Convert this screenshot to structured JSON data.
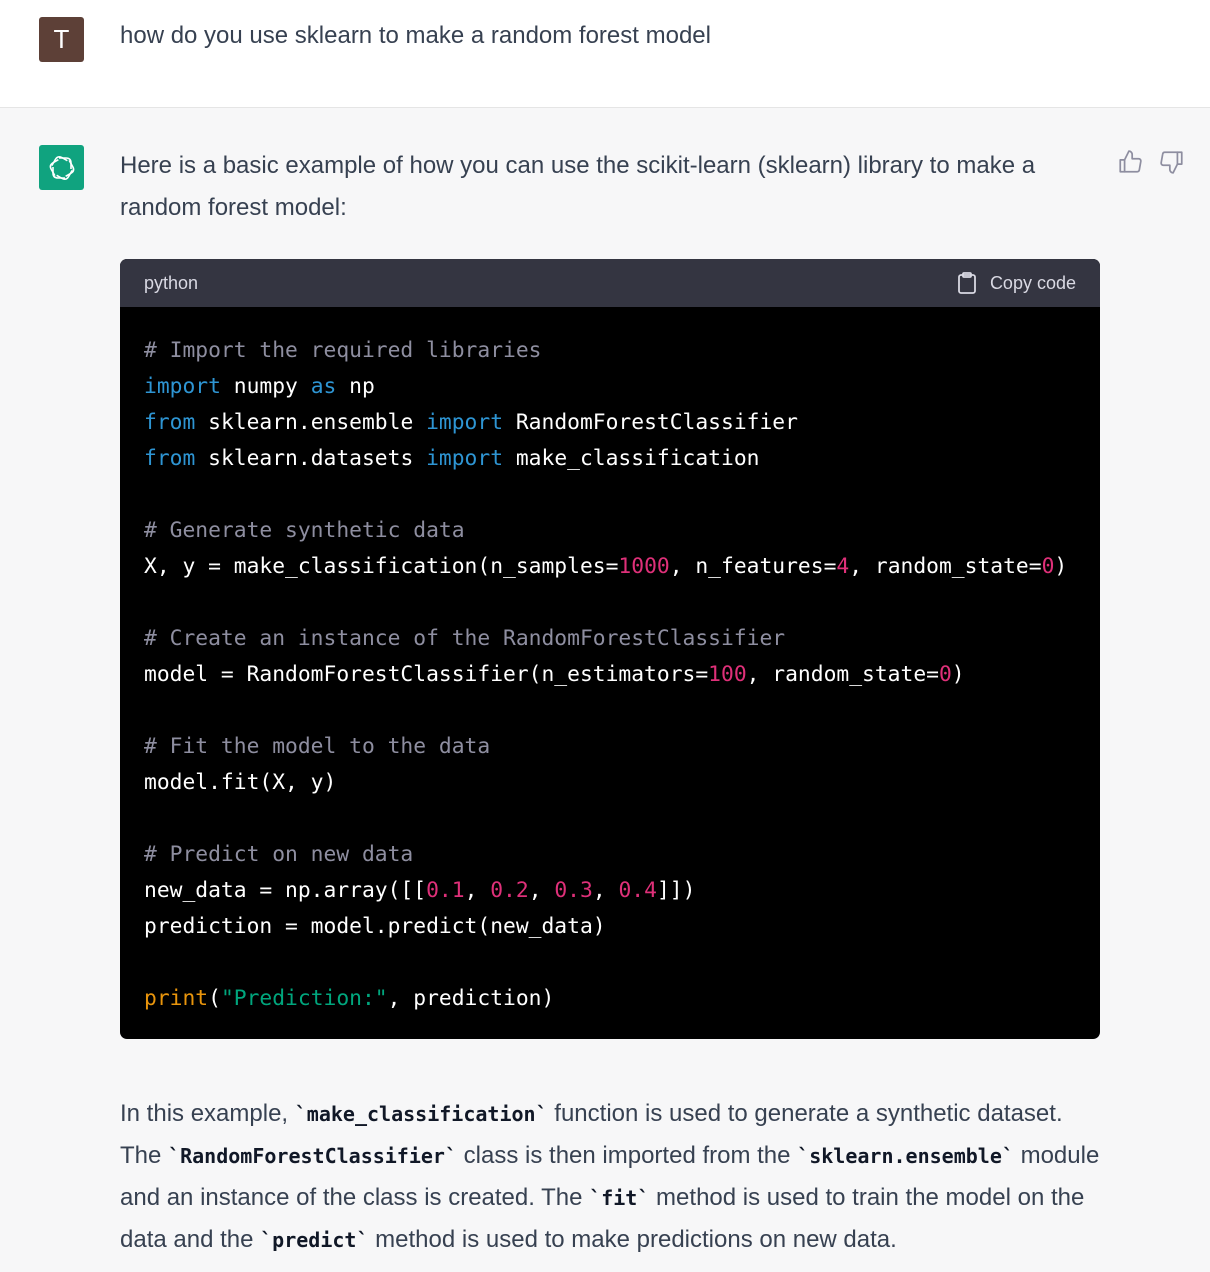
{
  "user_message": {
    "avatar_initial": "T",
    "text": "how do you use sklearn to make a random forest model"
  },
  "assistant_message": {
    "intro": "Here is a basic example of how you can use the scikit-learn (sklearn) library to make a random forest model:",
    "code_block": {
      "language": "python",
      "copy_label": "Copy code",
      "lines": [
        [
          {
            "t": "# Import the required libraries",
            "k": "comment"
          }
        ],
        [
          {
            "t": "import",
            "k": "keyword"
          },
          {
            "t": " numpy ",
            "k": "plain"
          },
          {
            "t": "as",
            "k": "keyword"
          },
          {
            "t": " np",
            "k": "plain"
          }
        ],
        [
          {
            "t": "from",
            "k": "keyword"
          },
          {
            "t": " sklearn.ensemble ",
            "k": "plain"
          },
          {
            "t": "import",
            "k": "keyword"
          },
          {
            "t": " RandomForestClassifier",
            "k": "plain"
          }
        ],
        [
          {
            "t": "from",
            "k": "keyword"
          },
          {
            "t": " sklearn.datasets ",
            "k": "plain"
          },
          {
            "t": "import",
            "k": "keyword"
          },
          {
            "t": " make_classification",
            "k": "plain"
          }
        ],
        [],
        [
          {
            "t": "# Generate synthetic data",
            "k": "comment"
          }
        ],
        [
          {
            "t": "X, y = make_classification(n_samples=",
            "k": "plain"
          },
          {
            "t": "1000",
            "k": "number"
          },
          {
            "t": ", n_features=",
            "k": "plain"
          },
          {
            "t": "4",
            "k": "number"
          },
          {
            "t": ", random_state=",
            "k": "plain"
          },
          {
            "t": "0",
            "k": "number"
          },
          {
            "t": ")",
            "k": "plain"
          }
        ],
        [],
        [
          {
            "t": "# Create an instance of the RandomForestClassifier",
            "k": "comment"
          }
        ],
        [
          {
            "t": "model = RandomForestClassifier(n_estimators=",
            "k": "plain"
          },
          {
            "t": "100",
            "k": "number"
          },
          {
            "t": ", random_state=",
            "k": "plain"
          },
          {
            "t": "0",
            "k": "number"
          },
          {
            "t": ")",
            "k": "plain"
          }
        ],
        [],
        [
          {
            "t": "# Fit the model to the data",
            "k": "comment"
          }
        ],
        [
          {
            "t": "model.fit(X, y)",
            "k": "plain"
          }
        ],
        [],
        [
          {
            "t": "# Predict on new data",
            "k": "comment"
          }
        ],
        [
          {
            "t": "new_data = np.array([[",
            "k": "plain"
          },
          {
            "t": "0.1",
            "k": "number"
          },
          {
            "t": ", ",
            "k": "plain"
          },
          {
            "t": "0.2",
            "k": "number"
          },
          {
            "t": ", ",
            "k": "plain"
          },
          {
            "t": "0.3",
            "k": "number"
          },
          {
            "t": ", ",
            "k": "plain"
          },
          {
            "t": "0.4",
            "k": "number"
          },
          {
            "t": "]])",
            "k": "plain"
          }
        ],
        [
          {
            "t": "prediction = model.predict(new_data)",
            "k": "plain"
          }
        ],
        [],
        [
          {
            "t": "print",
            "k": "builtin"
          },
          {
            "t": "(",
            "k": "plain"
          },
          {
            "t": "\"Prediction:\"",
            "k": "string"
          },
          {
            "t": ", prediction)",
            "k": "plain"
          }
        ]
      ]
    },
    "outro": {
      "p1": "In this example, ",
      "c1": "`make_classification`",
      "p2": " function is used to generate a synthetic dataset. The ",
      "c2": "`RandomForestClassifier`",
      "p3": " class is then imported from the ",
      "c3": "`sklearn.ensemble`",
      "p4": " module and an instance of the class is created. The ",
      "c4": "`fit`",
      "p5": " method is used to train the model on the data and the ",
      "c5": "`predict`",
      "p6": " method is used to make predictions on new data."
    }
  },
  "colors": {
    "user_avatar_bg": "#5d4037",
    "assistant_avatar_bg": "#10a37f",
    "code_bg": "#000000",
    "code_header_bg": "#343541"
  },
  "icons": {
    "assistant_avatar": "openai-logo-icon",
    "copy": "clipboard-icon",
    "like": "thumbs-up-icon",
    "dislike": "thumbs-down-icon"
  }
}
